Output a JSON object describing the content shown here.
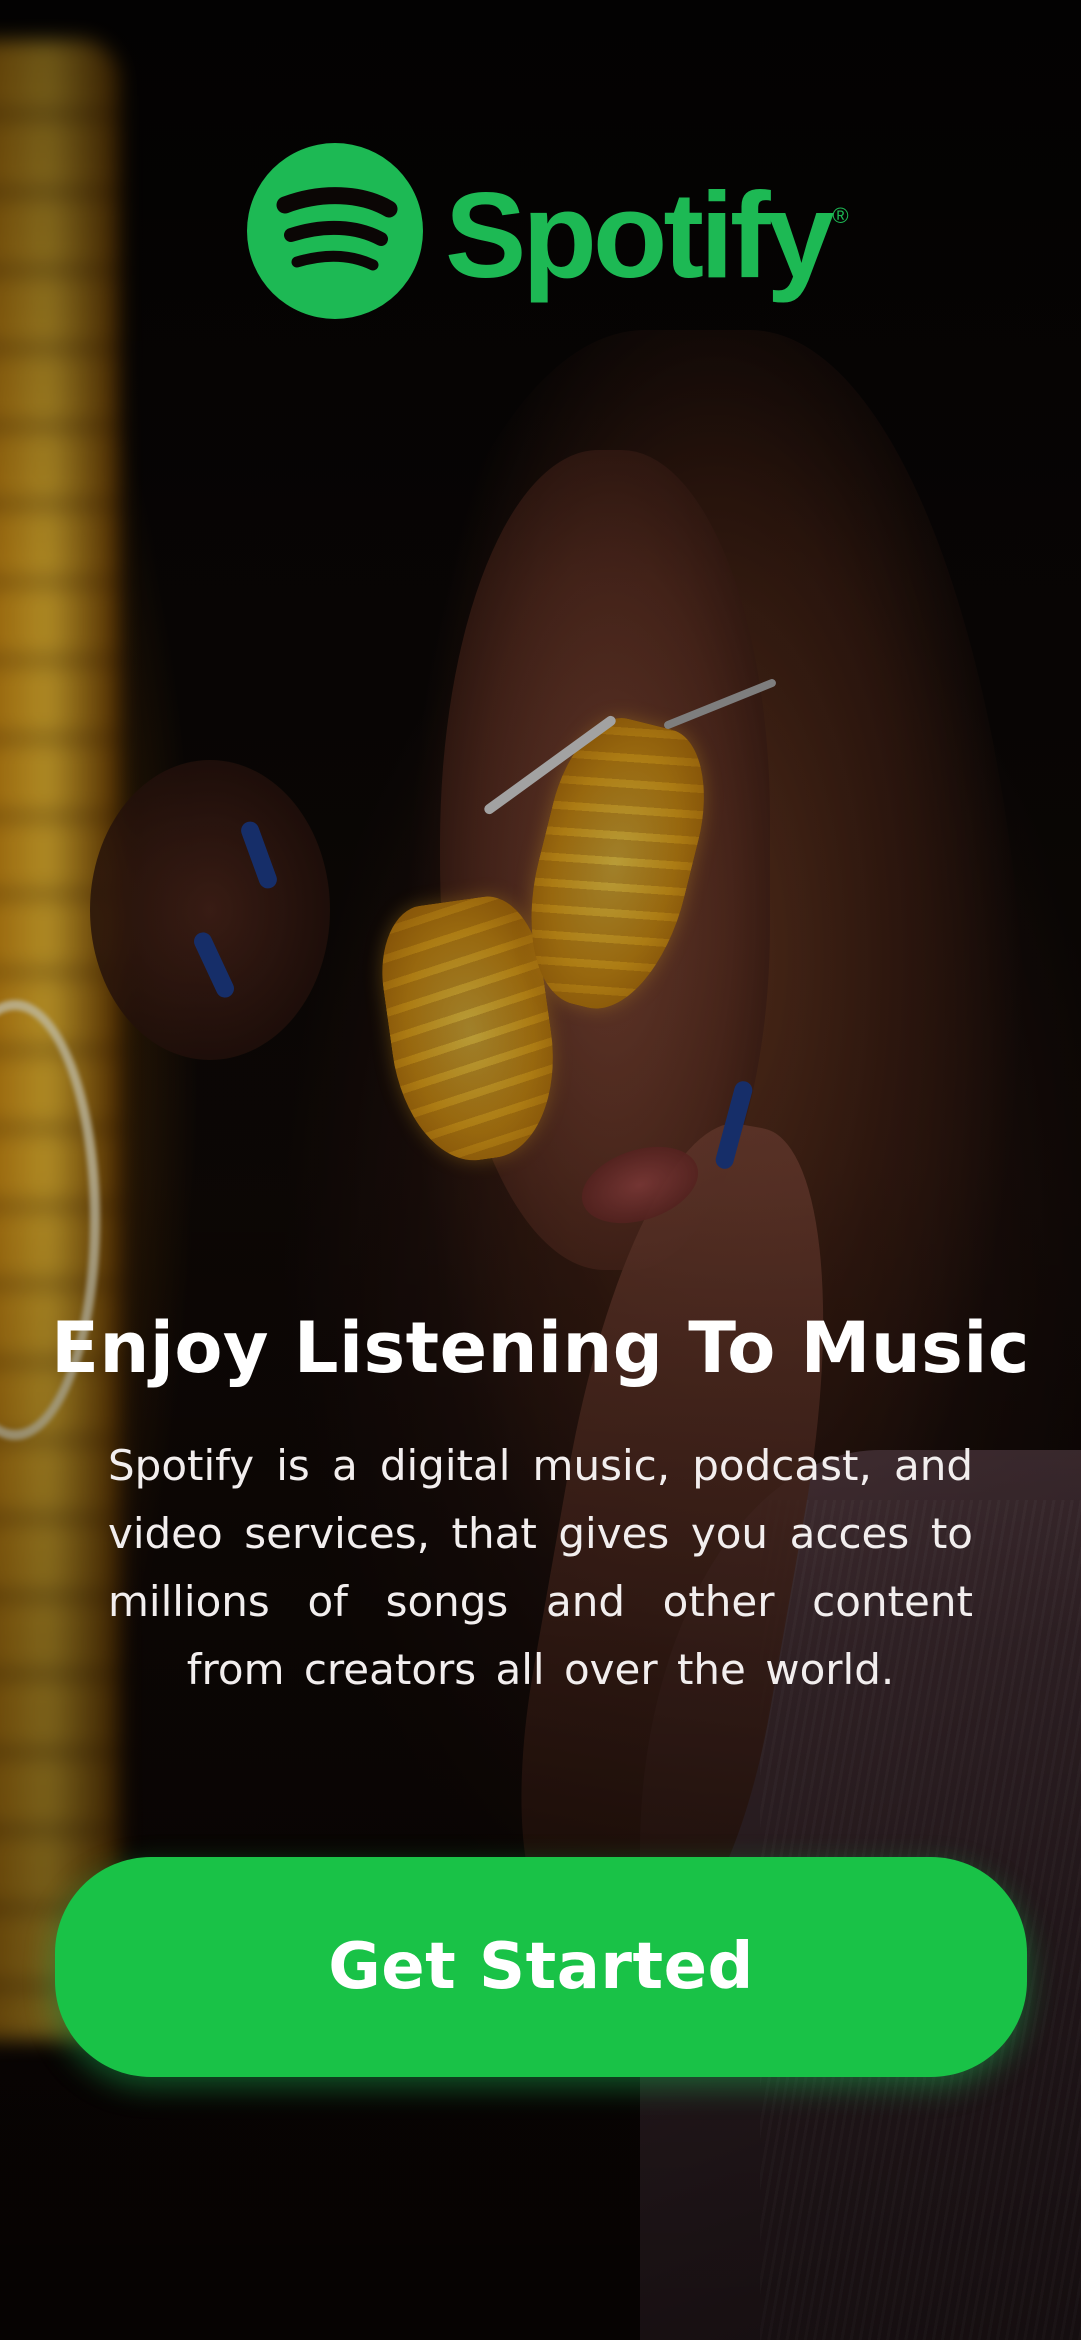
{
  "theme": {
    "brand_color": "#1DB954",
    "cta_color": "#19C247"
  },
  "logo": {
    "icon": "spotify-logo-icon",
    "wordmark": "Spotify",
    "registered": "®"
  },
  "headline": "Enjoy Listening To Music",
  "description": "Spotify is a digital music, podcast, and video services, that gives you acces to millions of songs and other content from creators all over the world.",
  "cta": {
    "label": "Get Started"
  }
}
